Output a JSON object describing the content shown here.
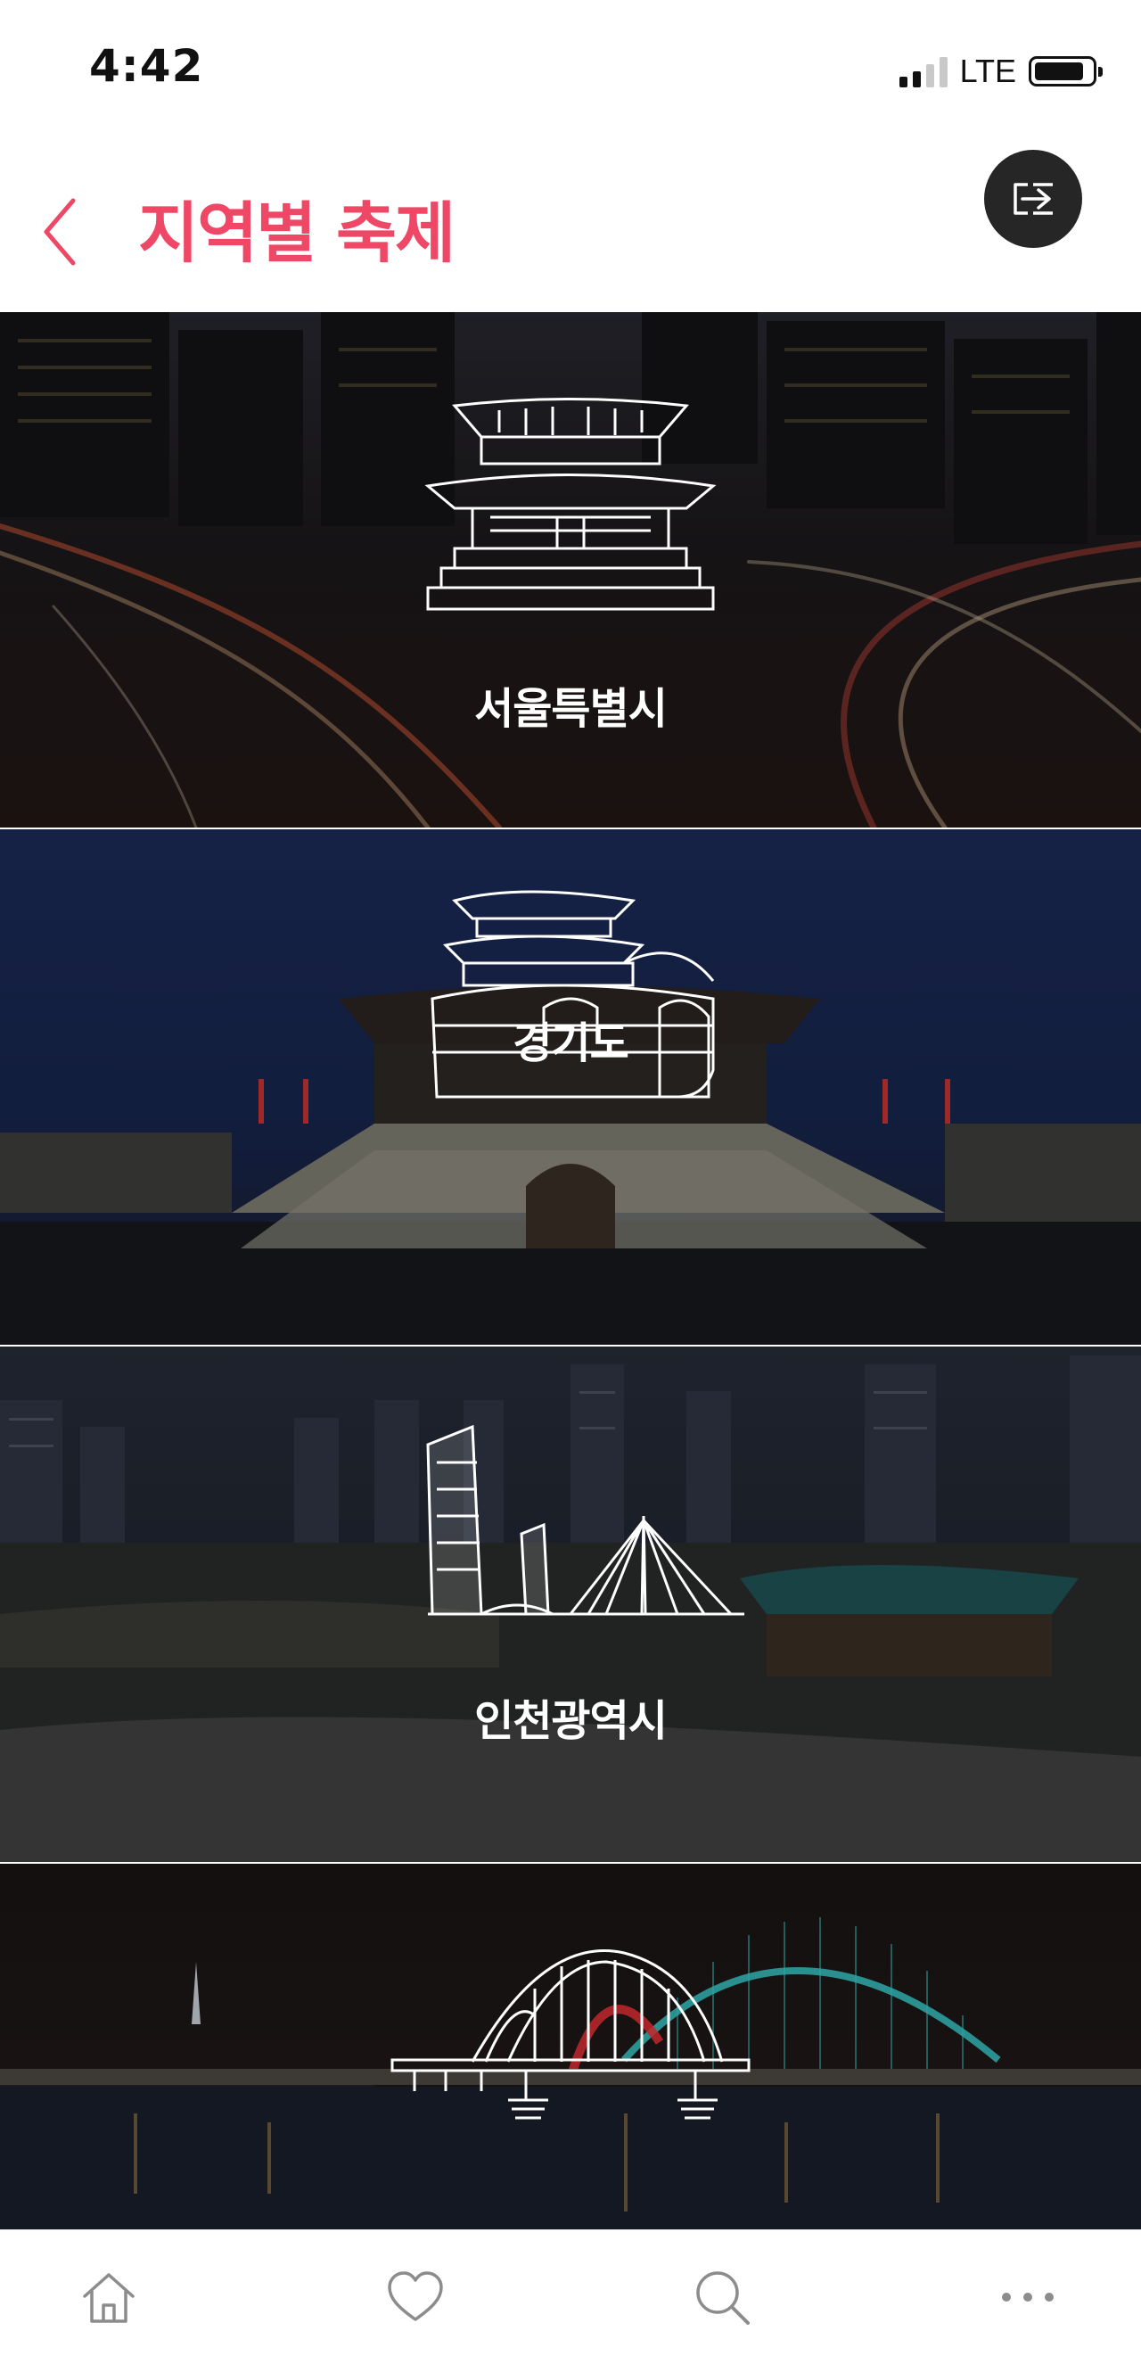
{
  "status_bar": {
    "time": "4:42",
    "network": "LTE"
  },
  "header": {
    "back_icon": "chevron-left-icon",
    "title": "지역별 축제",
    "exit_icon": "exit-icon"
  },
  "regions": [
    {
      "name": "서울특별시",
      "icon": "seoul-gate-icon"
    },
    {
      "name": "경기도",
      "icon": "suwon-fortress-icon"
    },
    {
      "name": "인천광역시",
      "icon": "incheon-skyline-icon"
    },
    {
      "name": "",
      "icon": "bridge-icon"
    }
  ],
  "bottom_nav": [
    {
      "icon": "home-icon"
    },
    {
      "icon": "heart-icon"
    },
    {
      "icon": "search-icon"
    },
    {
      "icon": "more-icon"
    }
  ],
  "colors": {
    "accent": "#ee4866",
    "exit_button": "#262626"
  }
}
